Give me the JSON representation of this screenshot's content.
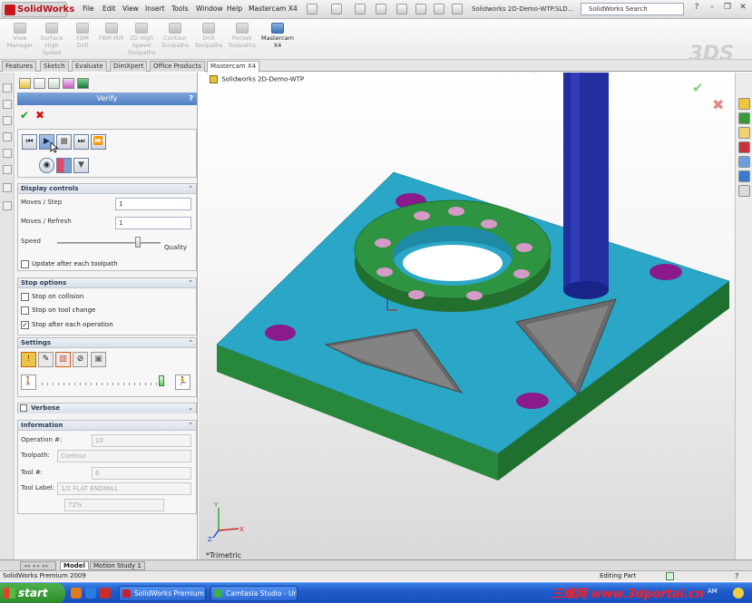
{
  "app": {
    "name": "SolidWorks",
    "menus": [
      "File",
      "Edit",
      "View",
      "Insert",
      "Tools",
      "Window",
      "Help",
      "Mastercam X4"
    ],
    "document_title": "Solidworks 2D-Demo-WTP.SLD...",
    "search_label": "SolidWorks Search"
  },
  "command_manager": {
    "buttons": [
      {
        "label": "View Manager",
        "enabled": false
      },
      {
        "label": "Surface High Speed",
        "enabled": false
      },
      {
        "label": "FBM Drill",
        "enabled": false
      },
      {
        "label": "FBM Mill",
        "enabled": false
      },
      {
        "label": "2D High Speed Toolpaths",
        "enabled": false
      },
      {
        "label": "Contour Toolpaths",
        "enabled": false
      },
      {
        "label": "Drill Toolpaths",
        "enabled": false
      },
      {
        "label": "Pocket Toolpaths",
        "enabled": false
      },
      {
        "label": "Mastercam X4",
        "enabled": true
      }
    ]
  },
  "tabs": [
    "Features",
    "Sketch",
    "Evaluate",
    "DimXpert",
    "Office Products",
    "Mastercam X4"
  ],
  "selected_tab": "Mastercam X4",
  "verify": {
    "title": "Verify",
    "help": "?",
    "display_controls": {
      "title": "Display controls",
      "moves_step_label": "Moves / Step",
      "moves_step_value": "1",
      "moves_refresh_label": "Moves / Refresh",
      "moves_refresh_value": "1",
      "speed_label": "Speed",
      "quality_label": "Quality",
      "speed_quality_fraction": 0.78,
      "update_label": "Update after each toolpath",
      "update_checked": false
    },
    "stop_options": {
      "title": "Stop options",
      "collision_label": "Stop on collision",
      "collision_checked": false,
      "toolchange_label": "Stop on tool change",
      "toolchange_checked": false,
      "operation_label": "Stop after each operation",
      "operation_checked": true
    },
    "settings": {
      "title": "Settings",
      "speed_fraction": 0.96
    },
    "verbose": {
      "title": "Verbose",
      "checked": false
    },
    "information": {
      "title": "Information",
      "operation_label": "Operation #:",
      "operation_value": "10",
      "toolpath_label": "Toolpath:",
      "toolpath_value": "Contour",
      "tool_label": "Tool #:",
      "tool_value": "6",
      "tool_label_label": "Tool Label:",
      "tool_label_value": "1/2 FLAT ENDMILL",
      "progress_value": "72%"
    }
  },
  "tree": {
    "part_name": "Solidworks 2D-Demo-WTP"
  },
  "viewport": {
    "view_name": "*Trimetric",
    "plate_color": "#2aa7c6",
    "boss_color": "#2b8b3a",
    "tool_color": "#232ea1",
    "hole_color": "#8a1a8e"
  },
  "bottom_tabs": [
    "Model",
    "Motion Study 1"
  ],
  "status": {
    "left": "SolidWorks Premium 2009",
    "right": "Editing Part"
  },
  "taskbar": {
    "start": "start",
    "buttons": [
      "SolidWorks Premium 2...",
      "Camtasia Studio - Unt..."
    ],
    "time": "AM",
    "watermark": "三维网 www.3dportal.cn"
  }
}
